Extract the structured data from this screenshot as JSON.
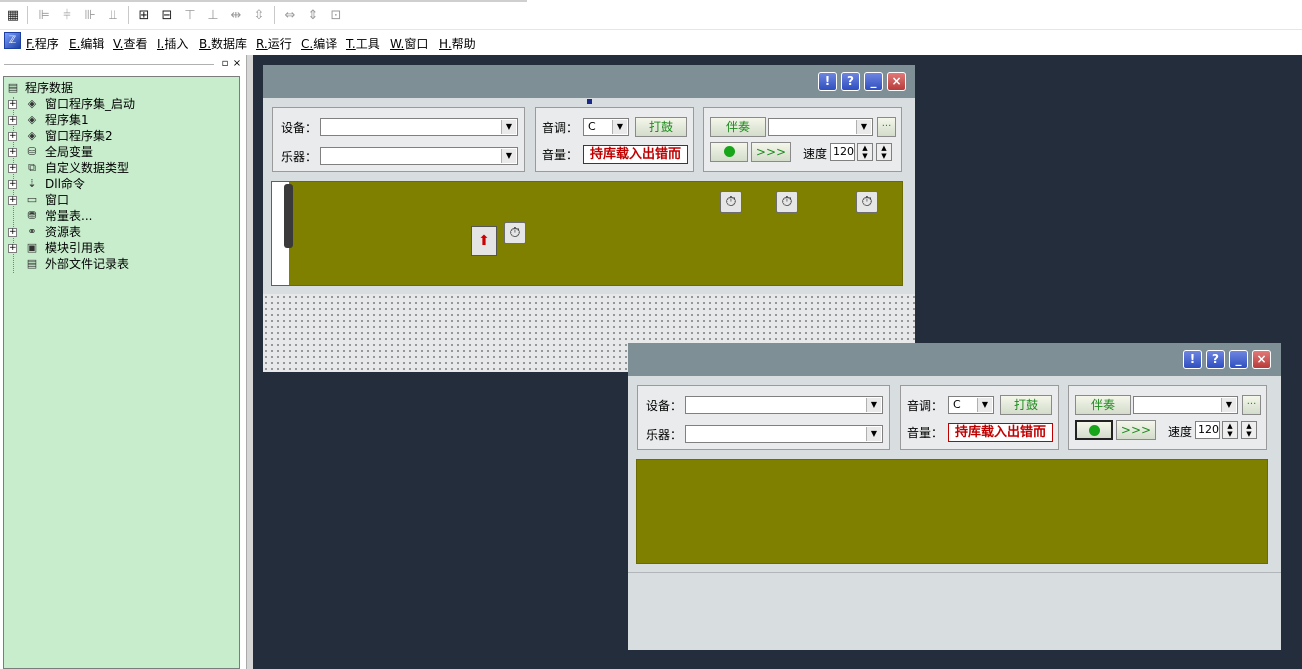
{
  "toolbar": {
    "icons": [
      "form-icon",
      "align-left-icon",
      "align-center-h-icon",
      "align-right-icon",
      "align-bottom-icon",
      "same-width-icon",
      "same-height-icon",
      "align-top-icon",
      "center-icon",
      "space-h-icon",
      "space-v-icon",
      "size-h-icon",
      "size-v-icon",
      "grid-icon"
    ]
  },
  "menu": {
    "items": [
      {
        "key": "F.",
        "label": "程序"
      },
      {
        "key": "E.",
        "label": "编辑"
      },
      {
        "key": "V.",
        "label": "查看"
      },
      {
        "key": "I.",
        "label": "插入"
      },
      {
        "key": "B.",
        "label": "数据库"
      },
      {
        "key": "R.",
        "label": "运行"
      },
      {
        "key": "C.",
        "label": "编译"
      },
      {
        "key": "T.",
        "label": "工具"
      },
      {
        "key": "W.",
        "label": "窗口"
      },
      {
        "key": "H.",
        "label": "帮助"
      }
    ]
  },
  "panel": {
    "pin_btn": "▫",
    "close_btn": "×"
  },
  "tree": {
    "root": "程序数据",
    "items": [
      "窗口程序集_启动",
      "程序集1",
      "窗口程序集2",
      "全局变量",
      "自定义数据类型",
      "Dll命令",
      "窗口",
      "常量表...",
      "资源表",
      "模块引用表",
      "外部文件记录表"
    ]
  },
  "form1": {
    "buttons": {
      "exclaim": "!",
      "help": "?",
      "minimize": "_",
      "close": "×"
    },
    "device_label": "设备：",
    "instrument_label": "乐器：",
    "tone_label": "音调：",
    "tone_value": "C",
    "drum_button": "打鼓",
    "volume_label": "音量：",
    "volume_text": "持库载入出错而",
    "accomp_button": "伴奏",
    "more_button": "···",
    "play_button_arrows": ">>>",
    "speed_label": "速度",
    "speed_value": "120"
  },
  "form2": {
    "buttons": {
      "exclaim": "!",
      "help": "?",
      "minimize": "_",
      "close": "×"
    },
    "device_label": "设备：",
    "instrument_label": "乐器：",
    "tone_label": "音调：",
    "tone_value": "C",
    "drum_button": "打鼓",
    "volume_label": "音量：",
    "volume_text": "持库载入出错而",
    "accomp_button": "伴奏",
    "more_button": "···",
    "play_button_arrows": ">>>",
    "speed_label": "速度",
    "speed_value": "120"
  }
}
